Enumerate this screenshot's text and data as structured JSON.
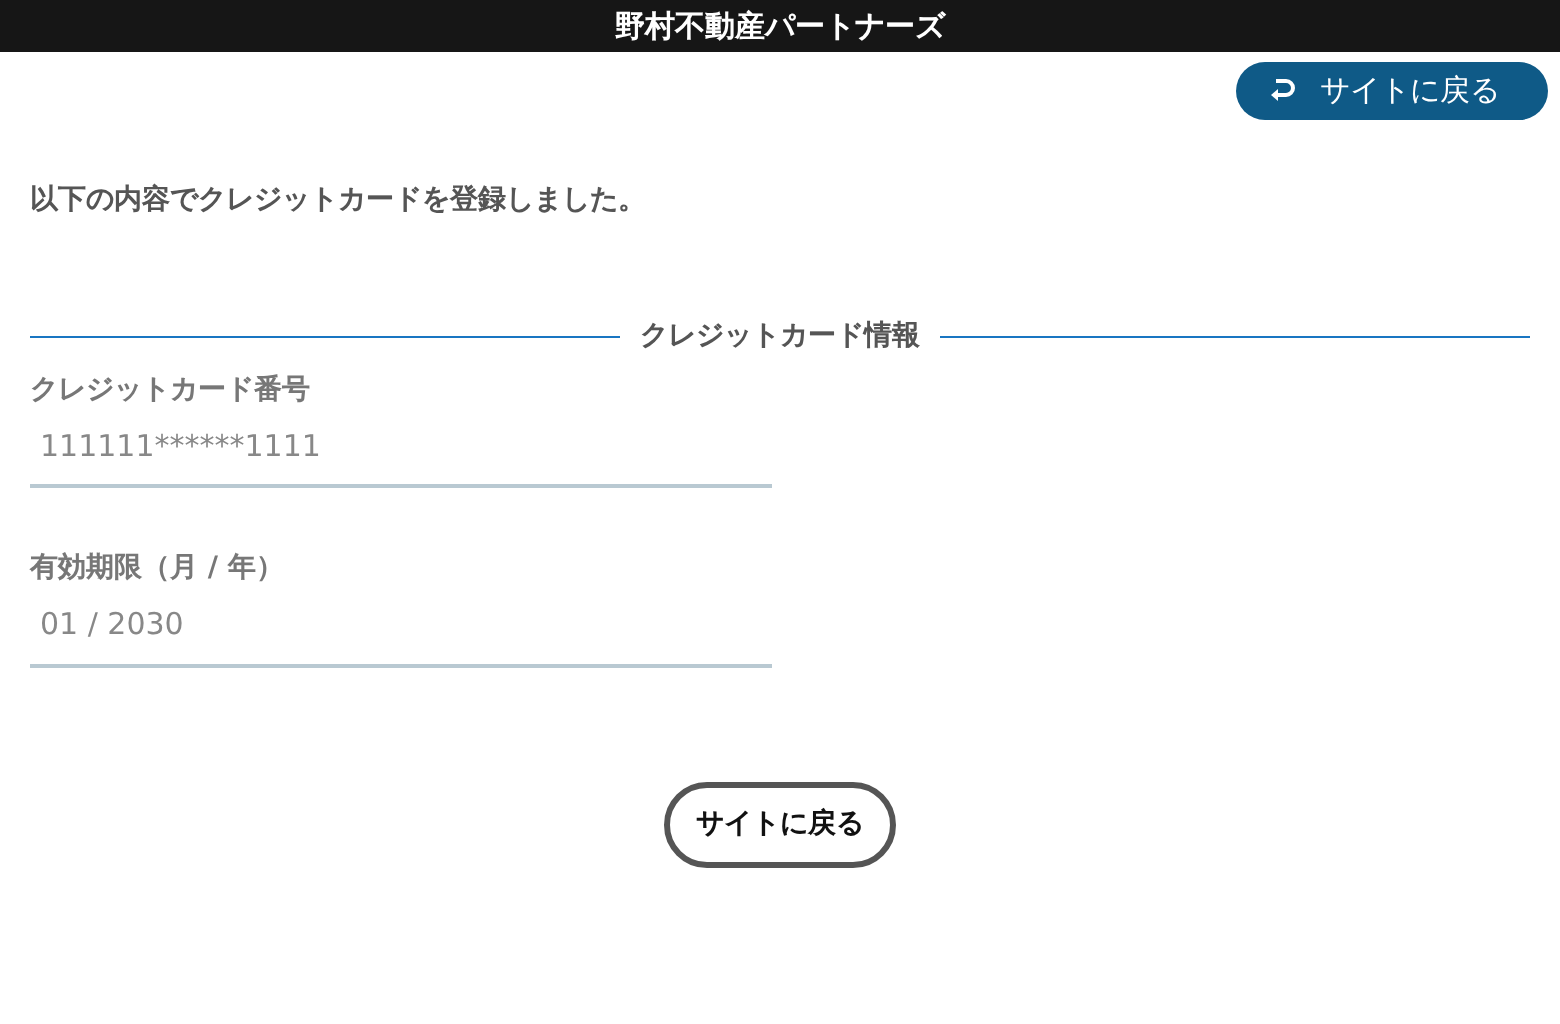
{
  "header": {
    "title": "野村不動産パートナーズ"
  },
  "top_button": {
    "label": "サイトに戻る"
  },
  "message": "以下の内容でクレジットカードを登録しました。",
  "section": {
    "title": "クレジットカード情報"
  },
  "fields": [
    {
      "label": "クレジットカード番号",
      "value": "111111******1111"
    },
    {
      "label": "有効期限（月 / 年）",
      "value": "01 / 2030"
    }
  ],
  "bottom_button": {
    "label": "サイトに戻る"
  }
}
